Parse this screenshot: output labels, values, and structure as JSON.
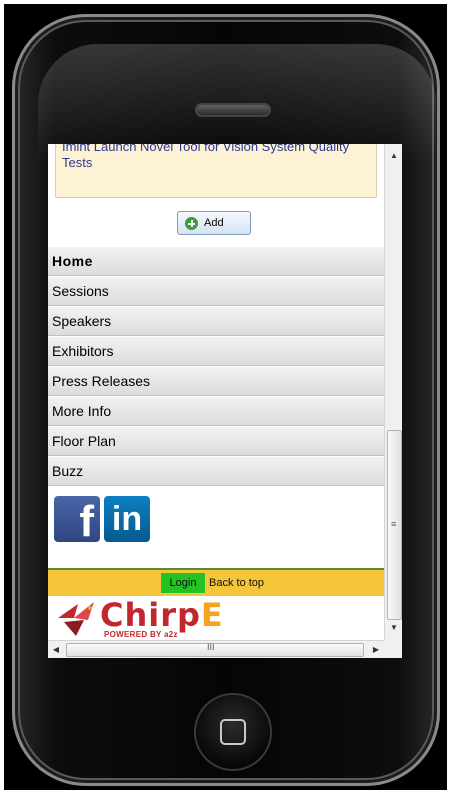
{
  "news": {
    "headline": "Imint Launch Novel Tool for Vision System Quality Tests"
  },
  "add_button": {
    "label": "Add"
  },
  "nav": {
    "items": [
      {
        "label": "Home"
      },
      {
        "label": "Sessions"
      },
      {
        "label": "Speakers"
      },
      {
        "label": "Exhibitors"
      },
      {
        "label": "Press Releases"
      },
      {
        "label": "More Info"
      },
      {
        "label": "Floor Plan"
      },
      {
        "label": "Buzz"
      }
    ]
  },
  "social": {
    "facebook": "f",
    "linkedin": "in"
  },
  "footer": {
    "login_label": "Login",
    "back_to_top_label": "Back to top"
  },
  "logo": {
    "word_main": "Chirp",
    "word_accent": "E",
    "tagline": "POWERED BY a2z"
  },
  "scrollbars": {
    "up": "▲",
    "down": "▼",
    "left": "◀",
    "right": "▶",
    "v_grip": "≡",
    "h_grip": "III"
  },
  "colors": {
    "footer_bar": "#f5c63a",
    "login_button": "#22c322",
    "news_text": "#2b3a8f",
    "logo_red": "#c2262e",
    "logo_orange": "#f4a51c"
  }
}
